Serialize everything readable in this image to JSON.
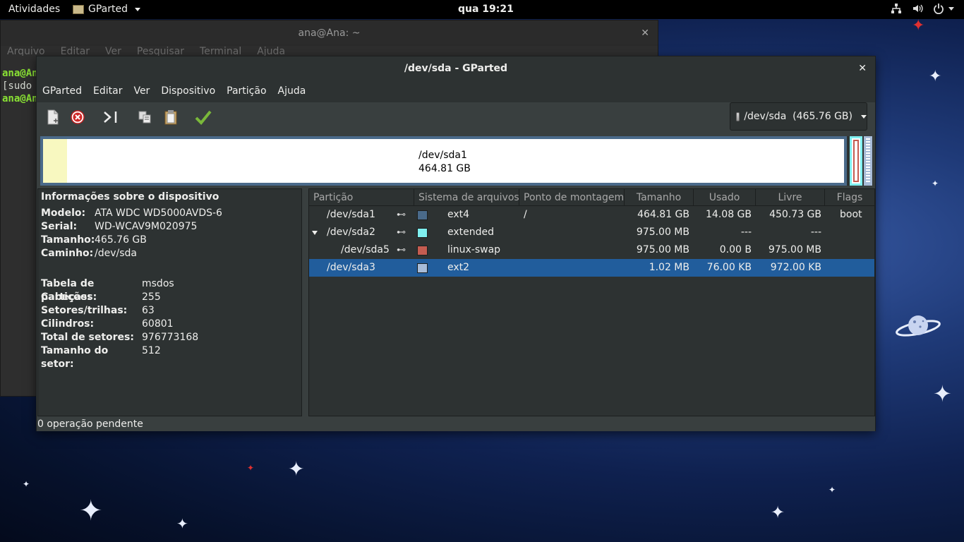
{
  "topbar": {
    "activities": "Atividades",
    "app_name": "GParted",
    "clock": "qua 19:21"
  },
  "terminal": {
    "title": "ana@Ana: ~",
    "menu": [
      "Arquivo",
      "Editar",
      "Ver",
      "Pesquisar",
      "Terminal",
      "Ajuda"
    ],
    "lines": [
      "ana@An",
      "[sudo",
      "ana@An"
    ]
  },
  "gparted": {
    "title": "/dev/sda - GParted",
    "menu": [
      "GParted",
      "Editar",
      "Ver",
      "Dispositivo",
      "Partição",
      "Ajuda"
    ],
    "device_selector": "/dev/sda  (465.76 GB)",
    "diskmap": {
      "partition": "/dev/sda1",
      "size": "464.81 GB"
    },
    "info": {
      "heading": "Informações sobre o dispositivo",
      "model_label": "Modelo:",
      "model": "ATA WDC WD5000AVDS-6",
      "serial_label": "Serial:",
      "serial": "WD-WCAV9M020975",
      "size_label": "Tamanho:",
      "size": "465.76 GB",
      "path_label": "Caminho:",
      "path": "/dev/sda",
      "table_label": "Tabela de partições:",
      "table": "msdos",
      "heads_label": "Cabeças:",
      "heads": "255",
      "sectors_label": "Setores/trilhas:",
      "sectors": "63",
      "cylinders_label": "Cilindros:",
      "cylinders": "60801",
      "total_label": "Total de setores:",
      "total": "976773168",
      "sector_size_label": "Tamanho do setor:",
      "sector_size": "512"
    },
    "columns": [
      "Partição",
      "Sistema de arquivos",
      "Ponto de montagem",
      "Tamanho",
      "Usado",
      "Livre",
      "Flags"
    ],
    "rows": [
      {
        "partition": "/dev/sda1",
        "fs": "ext4",
        "mount": "/",
        "size": "464.81 GB",
        "used": "14.08 GB",
        "free": "450.73 GB",
        "flags": "boot",
        "color": "#4a6a8a"
      },
      {
        "partition": "/dev/sda2",
        "fs": "extended",
        "mount": "",
        "size": "975.00 MB",
        "used": "---",
        "free": "---",
        "flags": "",
        "color": "#7ff0f0"
      },
      {
        "partition": "/dev/sda5",
        "fs": "linux-swap",
        "mount": "",
        "size": "975.00 MB",
        "used": "0.00 B",
        "free": "975.00 MB",
        "flags": "",
        "color": "#c45c50"
      },
      {
        "partition": "/dev/sda3",
        "fs": "ext2",
        "mount": "",
        "size": "1.02 MB",
        "used": "76.00 KB",
        "free": "972.00 KB",
        "flags": "",
        "color": "#a8bcd8"
      }
    ],
    "status": "0 operação pendente"
  }
}
